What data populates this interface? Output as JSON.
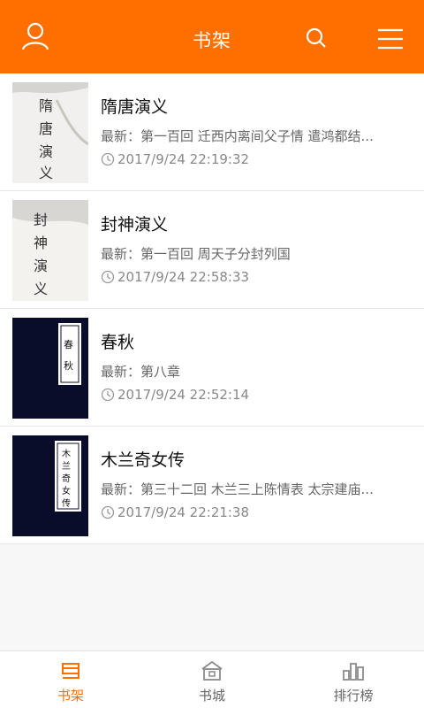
{
  "header": {
    "title": "书架"
  },
  "books": [
    {
      "title": "隋唐演义",
      "latest": "最新：第一百回 迁西内离间父子情 遣鸿都结...",
      "time": "2017/9/24 22:19:32",
      "cover_text": "隋唐演义"
    },
    {
      "title": "封神演义",
      "latest": "最新：第一百回 周天子分封列国",
      "time": "2017/9/24 22:58:33",
      "cover_text": "封神演义"
    },
    {
      "title": "春秋",
      "latest": "最新：第八章",
      "time": "2017/9/24 22:52:14",
      "cover_text": "春秋"
    },
    {
      "title": "木兰奇女传",
      "latest": "最新：第三十二回 木兰三上陈情表 太宗建庙...",
      "time": "2017/9/24 22:21:38",
      "cover_text": "木兰奇女传"
    }
  ],
  "tabs": [
    {
      "label": "书架",
      "icon": "bookshelf-icon",
      "active": true
    },
    {
      "label": "书城",
      "icon": "store-icon",
      "active": false
    },
    {
      "label": "排行榜",
      "icon": "ranking-icon",
      "active": false
    }
  ],
  "colors": {
    "accent": "#ff6f00",
    "cover_dark": "#0a0d2a"
  }
}
